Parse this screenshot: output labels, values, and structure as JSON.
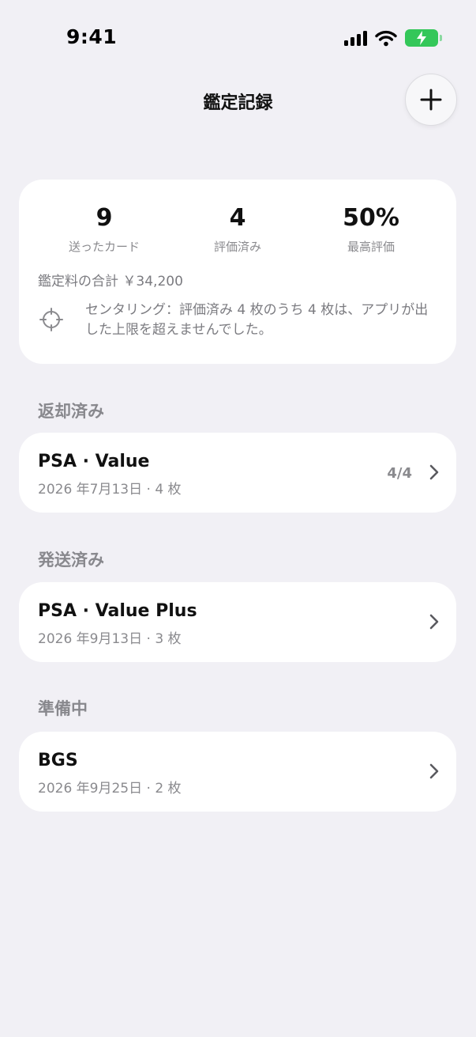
{
  "status_bar": {
    "time": "9:41"
  },
  "nav": {
    "title": "鑑定記録",
    "add_icon": "plus-icon"
  },
  "summary": {
    "stats": [
      {
        "value": "9",
        "label": "送ったカード"
      },
      {
        "value": "4",
        "label": "評価済み"
      },
      {
        "value": "50%",
        "label": "最高評価"
      }
    ],
    "fee_label": "鑑定料の合計 ￥34,200",
    "centering_icon": "crosshair-icon",
    "centering_text": "センタリング：評価済み 4 枚のうち 4 枚は、アプリが出した上限を超えませんでした。"
  },
  "sections": [
    {
      "header": "返却済み",
      "item": {
        "title": "PSA · Value",
        "subtitle": "2026 年7月13日 · 4 枚",
        "count": "4/4"
      }
    },
    {
      "header": "発送済み",
      "item": {
        "title": "PSA · Value Plus",
        "subtitle": "2026 年9月13日 · 3 枚"
      }
    },
    {
      "header": "準備中",
      "item": {
        "title": "BGS",
        "subtitle": "2026 年9月25日 · 2 枚"
      }
    }
  ],
  "colors": {
    "background": "#f1f0f5",
    "card": "#ffffff",
    "secondary_text": "#8a8a8e",
    "battery": "#34c759"
  }
}
